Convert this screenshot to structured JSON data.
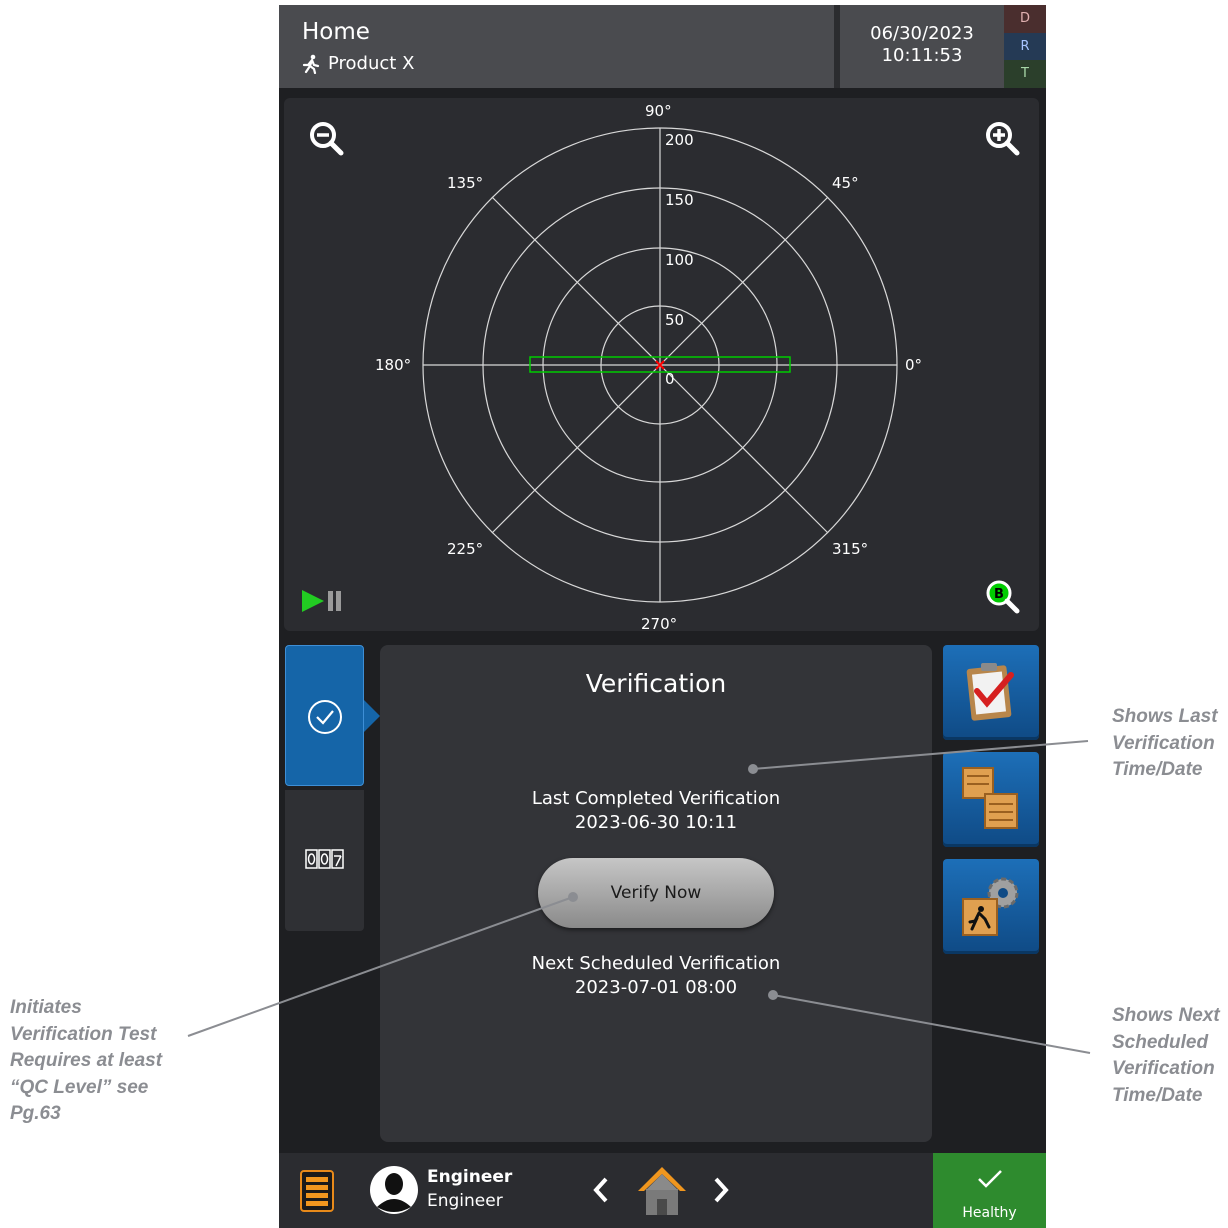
{
  "header": {
    "title": "Home",
    "product": "Product X",
    "date": "06/30/2023",
    "time": "10:11:53",
    "status_letters": [
      "D",
      "R",
      "T"
    ]
  },
  "polar": {
    "angle_labels": [
      "90°",
      "45°",
      "0°",
      "315°",
      "270°",
      "225°",
      "180°",
      "135°"
    ],
    "radial_labels": [
      "200",
      "150",
      "100",
      "50",
      "0"
    ],
    "marker_color": "#00cc00",
    "center_color": "#ff0000",
    "zoom_out_icon": "zoom-out-icon",
    "zoom_in_icon": "zoom-in-icon",
    "zoom_b_label": "B"
  },
  "verification": {
    "title": "Verification",
    "last_label": "Last Completed Verification",
    "last_value": "2023-06-30 10:11",
    "button_label": "Verify Now",
    "next_label": "Next Scheduled Verification",
    "next_value": "2023-07-01 08:00"
  },
  "footer": {
    "user_name": "Engineer",
    "user_role": "Engineer",
    "status_label": "Healthy"
  },
  "annotations": {
    "last": [
      "Shows Last",
      "Verification",
      "Time/Date"
    ],
    "next": [
      "Shows Next",
      "Scheduled",
      "Verification",
      "Time/Date"
    ],
    "button": [
      "Initiates",
      "Verification Test",
      "Requires at least",
      "“QC Level” see",
      "Pg.63"
    ]
  },
  "colors": {
    "accent_blue": "#1565a8",
    "healthy_green": "#2e8b2e",
    "annotation_gray": "#8b8d92"
  }
}
